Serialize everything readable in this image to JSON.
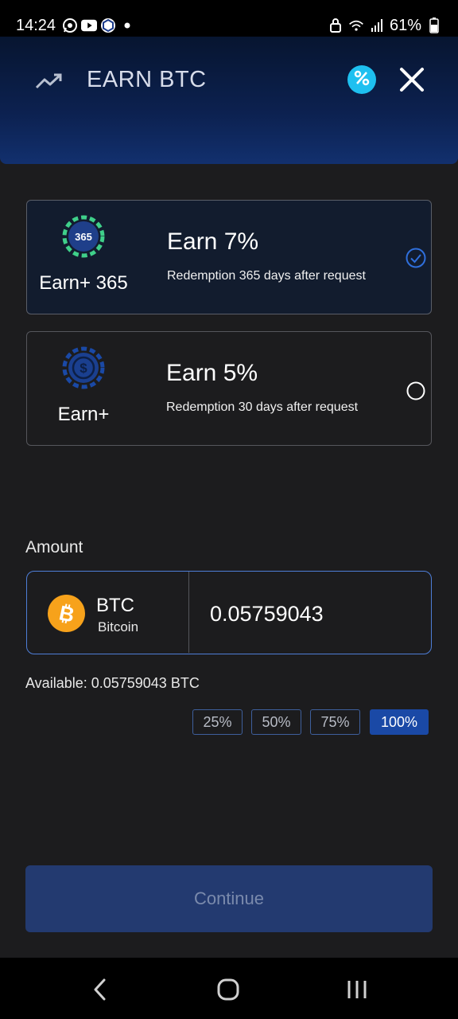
{
  "status_bar": {
    "time": "14:24",
    "battery": "61%",
    "left_icons": [
      "whatsapp-icon",
      "youtube-icon",
      "cronos-icon",
      "dot-icon"
    ],
    "right_icons": [
      "lock-icon",
      "wifi-icon",
      "signal-icon",
      "battery-icon"
    ]
  },
  "header": {
    "title": "EARN BTC",
    "left_icon": "trend-up-icon",
    "badge_icon": "percent-badge-icon",
    "close_icon": "close-icon",
    "badge_color": "#1ec0f0"
  },
  "options": [
    {
      "name": "Earn+ 365",
      "badge_text": "365",
      "rate": "Earn 7%",
      "description": "Redemption 365 days after request",
      "selected": true,
      "badge_color": "#3fd08a"
    },
    {
      "name": "Earn+",
      "badge_text": "",
      "rate": "Earn 5%",
      "description": "Redemption 30 days after request",
      "selected": false,
      "badge_color": "#1a49a6"
    }
  ],
  "amount": {
    "label": "Amount",
    "coin_symbol": "BTC",
    "coin_name": "Bitcoin",
    "value": "0.05759043",
    "available": "Available: 0.05759043 BTC",
    "coin_color": "#f7a21b"
  },
  "percent_buttons": [
    {
      "label": "25%",
      "active": false
    },
    {
      "label": "50%",
      "active": false
    },
    {
      "label": "75%",
      "active": false
    },
    {
      "label": "100%",
      "active": true
    }
  ],
  "continue_label": "Continue",
  "nav": {
    "back_icon": "back-icon",
    "home_icon": "home-icon",
    "recents_icon": "recents-icon"
  },
  "colors": {
    "accent": "#1a49a6",
    "focus_border": "#4e7ed8",
    "background": "#1c1c1e"
  }
}
